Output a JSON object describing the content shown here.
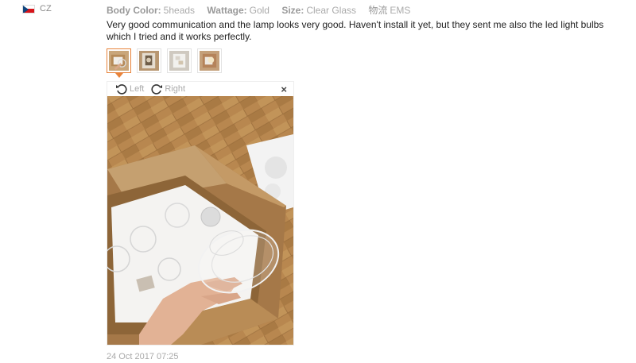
{
  "reviewer": {
    "country": "CZ",
    "flag_colors": [
      "#ffffff",
      "#d7141a",
      "#11457e"
    ]
  },
  "properties": [
    {
      "key": "Body Color:",
      "value": "5heads"
    },
    {
      "key": "Wattage:",
      "value": "Gold"
    },
    {
      "key": "Size:",
      "value": "Clear Glass"
    },
    {
      "key": "物流",
      "value": "EMS"
    }
  ],
  "review_text": "Very good communication and the lamp looks very good. Haven't install it yet, but they sent me also the led light bulbs which I tried and it works perfectly.",
  "thumbnails": [
    {
      "name": "thumbnail-1",
      "active": true
    },
    {
      "name": "thumbnail-2",
      "active": false
    },
    {
      "name": "thumbnail-3",
      "active": false
    },
    {
      "name": "thumbnail-4",
      "active": false
    }
  ],
  "viewer": {
    "rotate_left_label": "Left",
    "rotate_right_label": "Right",
    "close_label": "×",
    "accent_color": "#e8833a"
  },
  "review_date": "24 Oct 2017 07:25"
}
